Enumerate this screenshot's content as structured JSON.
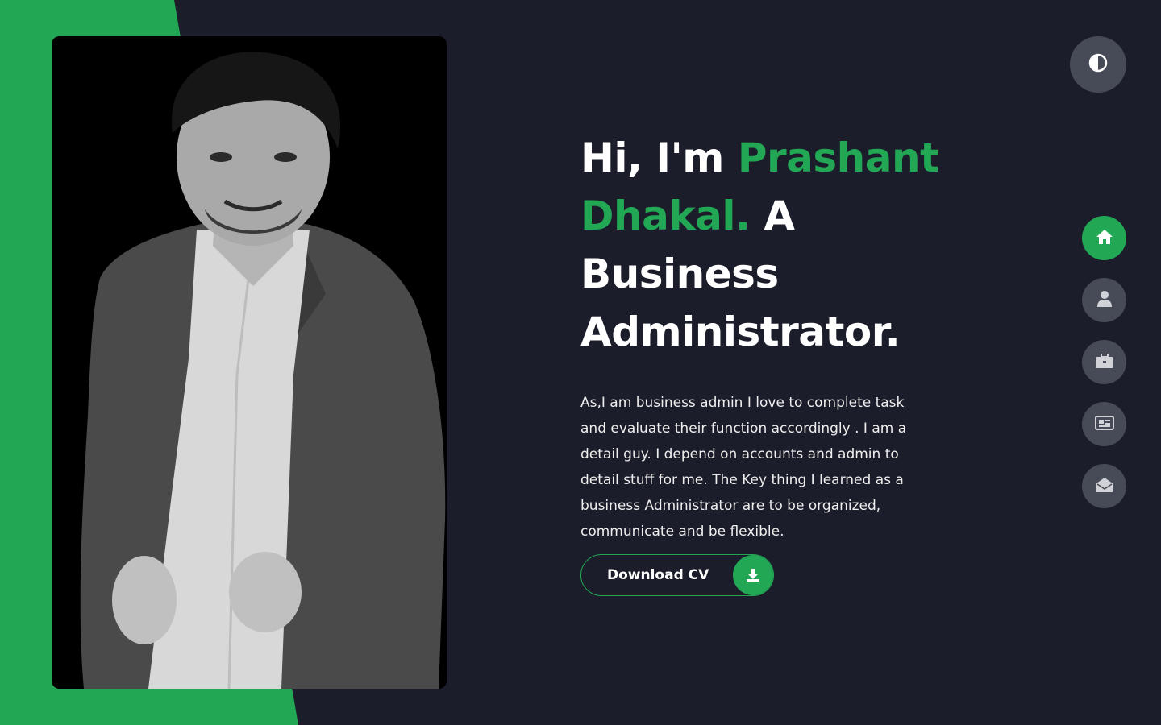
{
  "hero": {
    "greeting": "Hi, I'm",
    "name_first": "Prashant",
    "name_last": "Dhakal.",
    "role_prefix": "A",
    "role_word1": "Business",
    "role_word2": "Administrator.",
    "bio": "As,I am business admin I love to complete task and evaluate their function accordingly . I am a detail guy. I depend on accounts and admin to detail stuff for me. The Key thing I learned as a business Administrator are to be organized, communicate and be flexible.",
    "download_label": "Download CV"
  },
  "nav": {
    "items": [
      {
        "icon": "home-icon",
        "active": true
      },
      {
        "icon": "user-icon",
        "active": false
      },
      {
        "icon": "briefcase-icon",
        "active": false
      },
      {
        "icon": "newspaper-icon",
        "active": false
      },
      {
        "icon": "envelope-open-icon",
        "active": false
      }
    ]
  },
  "theme_toggle": {
    "icon": "contrast-icon"
  },
  "colors": {
    "accent": "#22a855",
    "background": "#1b1d2a",
    "nav_button": "#474b57",
    "text": "#ffffff"
  }
}
